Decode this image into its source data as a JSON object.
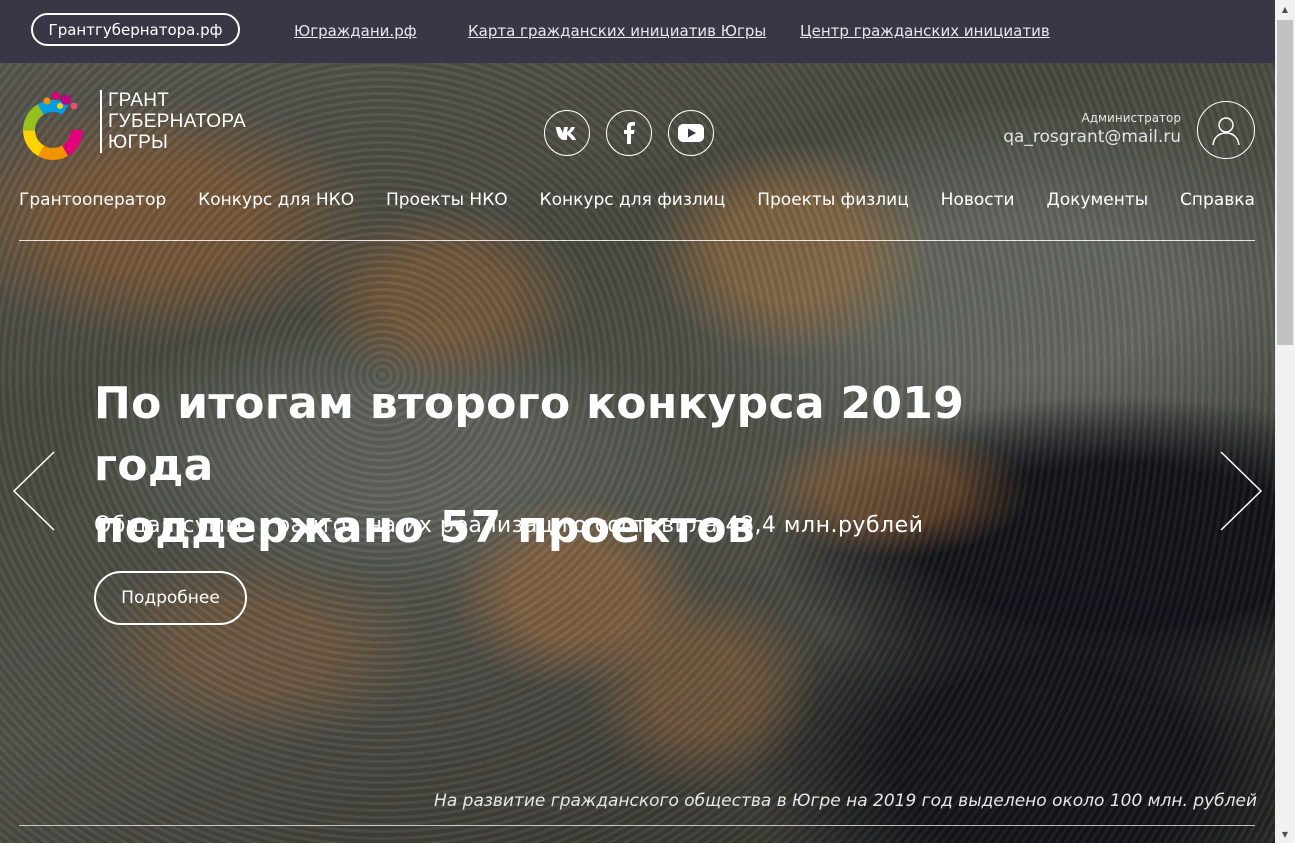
{
  "topbar": {
    "pill_label": "Грантгубернатора.рф",
    "links": [
      "Юграждани.рф",
      "Карта гражданских инициатив Югры",
      "Центр гражданских инициатив"
    ]
  },
  "logo": {
    "line1": "ГРАНТ",
    "line2": "ГУБЕРНАТОРА",
    "line3": "ЮГРЫ"
  },
  "socials": {
    "vk": "vk-icon",
    "facebook": "facebook-icon",
    "youtube": "youtube-icon"
  },
  "user": {
    "role": "Администратор",
    "email": "qa_rosgrant@mail.ru"
  },
  "nav": [
    "Грантооператор",
    "Конкурс для НКО",
    "Проекты НКО",
    "Конкурс для физлиц",
    "Проекты физлиц",
    "Новости",
    "Документы",
    "Справка"
  ],
  "slide": {
    "title_line1": "По итогам второго конкурса 2019 года",
    "title_line2": "поддержано 57 проектов",
    "subtitle": "Общая сумма грантов на их реализацию составила 48,4 млн.рублей",
    "button": "Подробнее",
    "caption": "На развитие гражданского общества в Югре на 2019 год выделено около 100 млн. рублей"
  }
}
